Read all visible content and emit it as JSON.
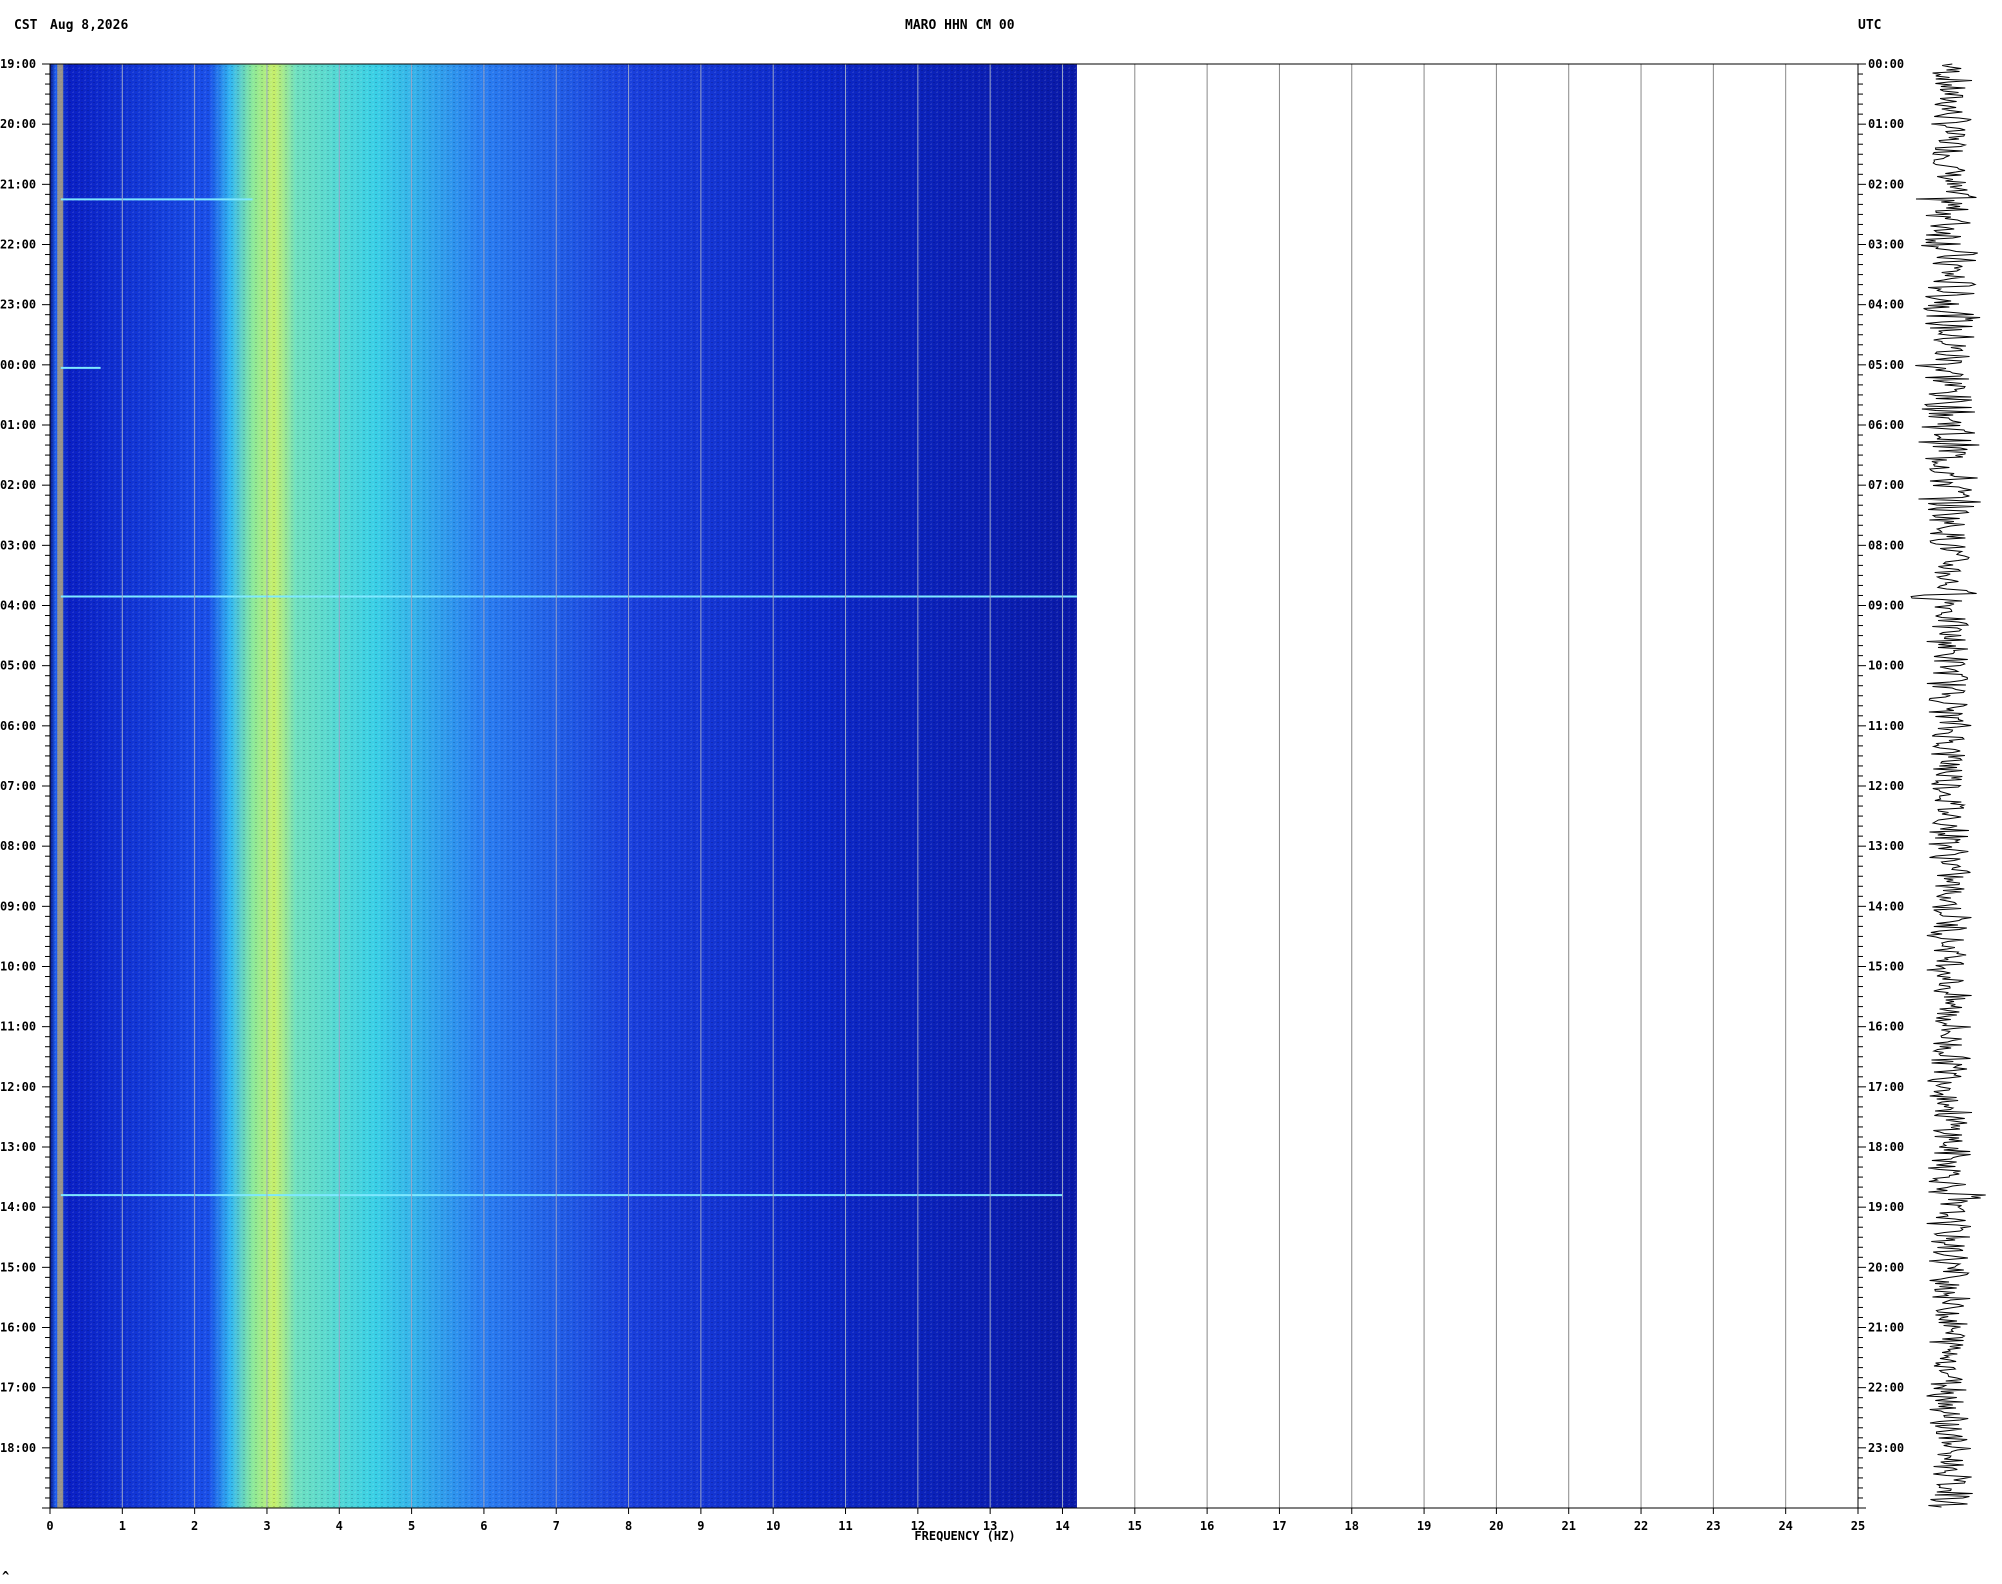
{
  "header": {
    "left_tz": "CST",
    "date": "Aug 8,2026",
    "station": "MARO HHN CM 00",
    "right_tz": "UTC"
  },
  "colors": {
    "background": "#0a1fc4",
    "energy_band": "#33d6e6",
    "energy_peak": "#e8ef4a",
    "gridline": "#888888"
  },
  "chart_data": {
    "type": "heatmap",
    "title": "MARO HHN CM 00",
    "xlabel": "FREQUENCY (HZ)",
    "xlim": [
      0,
      25
    ],
    "x_ticks": [
      "0",
      "1",
      "2",
      "3",
      "4",
      "5",
      "6",
      "7",
      "8",
      "9",
      "10",
      "11",
      "12",
      "13",
      "14",
      "15",
      "16",
      "17",
      "18",
      "19",
      "20",
      "21",
      "22",
      "23",
      "24",
      "25"
    ],
    "data_max_frequency": 14.2,
    "left_time_labels": [
      "19:00",
      "20:00",
      "21:00",
      "22:00",
      "23:00",
      "00:00",
      "01:00",
      "02:00",
      "03:00",
      "04:00",
      "05:00",
      "06:00",
      "07:00",
      "08:00",
      "09:00",
      "10:00",
      "11:00",
      "12:00",
      "13:00",
      "14:00",
      "15:00",
      "16:00",
      "17:00",
      "18:00"
    ],
    "right_time_labels": [
      "00:00",
      "01:00",
      "02:00",
      "03:00",
      "04:00",
      "05:00",
      "06:00",
      "07:00",
      "08:00",
      "09:00",
      "10:00",
      "11:00",
      "12:00",
      "13:00",
      "14:00",
      "15:00",
      "16:00",
      "17:00",
      "18:00",
      "19:00",
      "20:00",
      "21:00",
      "22:00",
      "23:00"
    ],
    "energy_band_hz": [
      2.5,
      6.0
    ],
    "peak_band_hz": [
      2.8,
      3.4
    ],
    "broadband_events_utc_hour": [
      2.25,
      5.05,
      8.85,
      18.8
    ]
  },
  "footer": {
    "mark": "^"
  }
}
